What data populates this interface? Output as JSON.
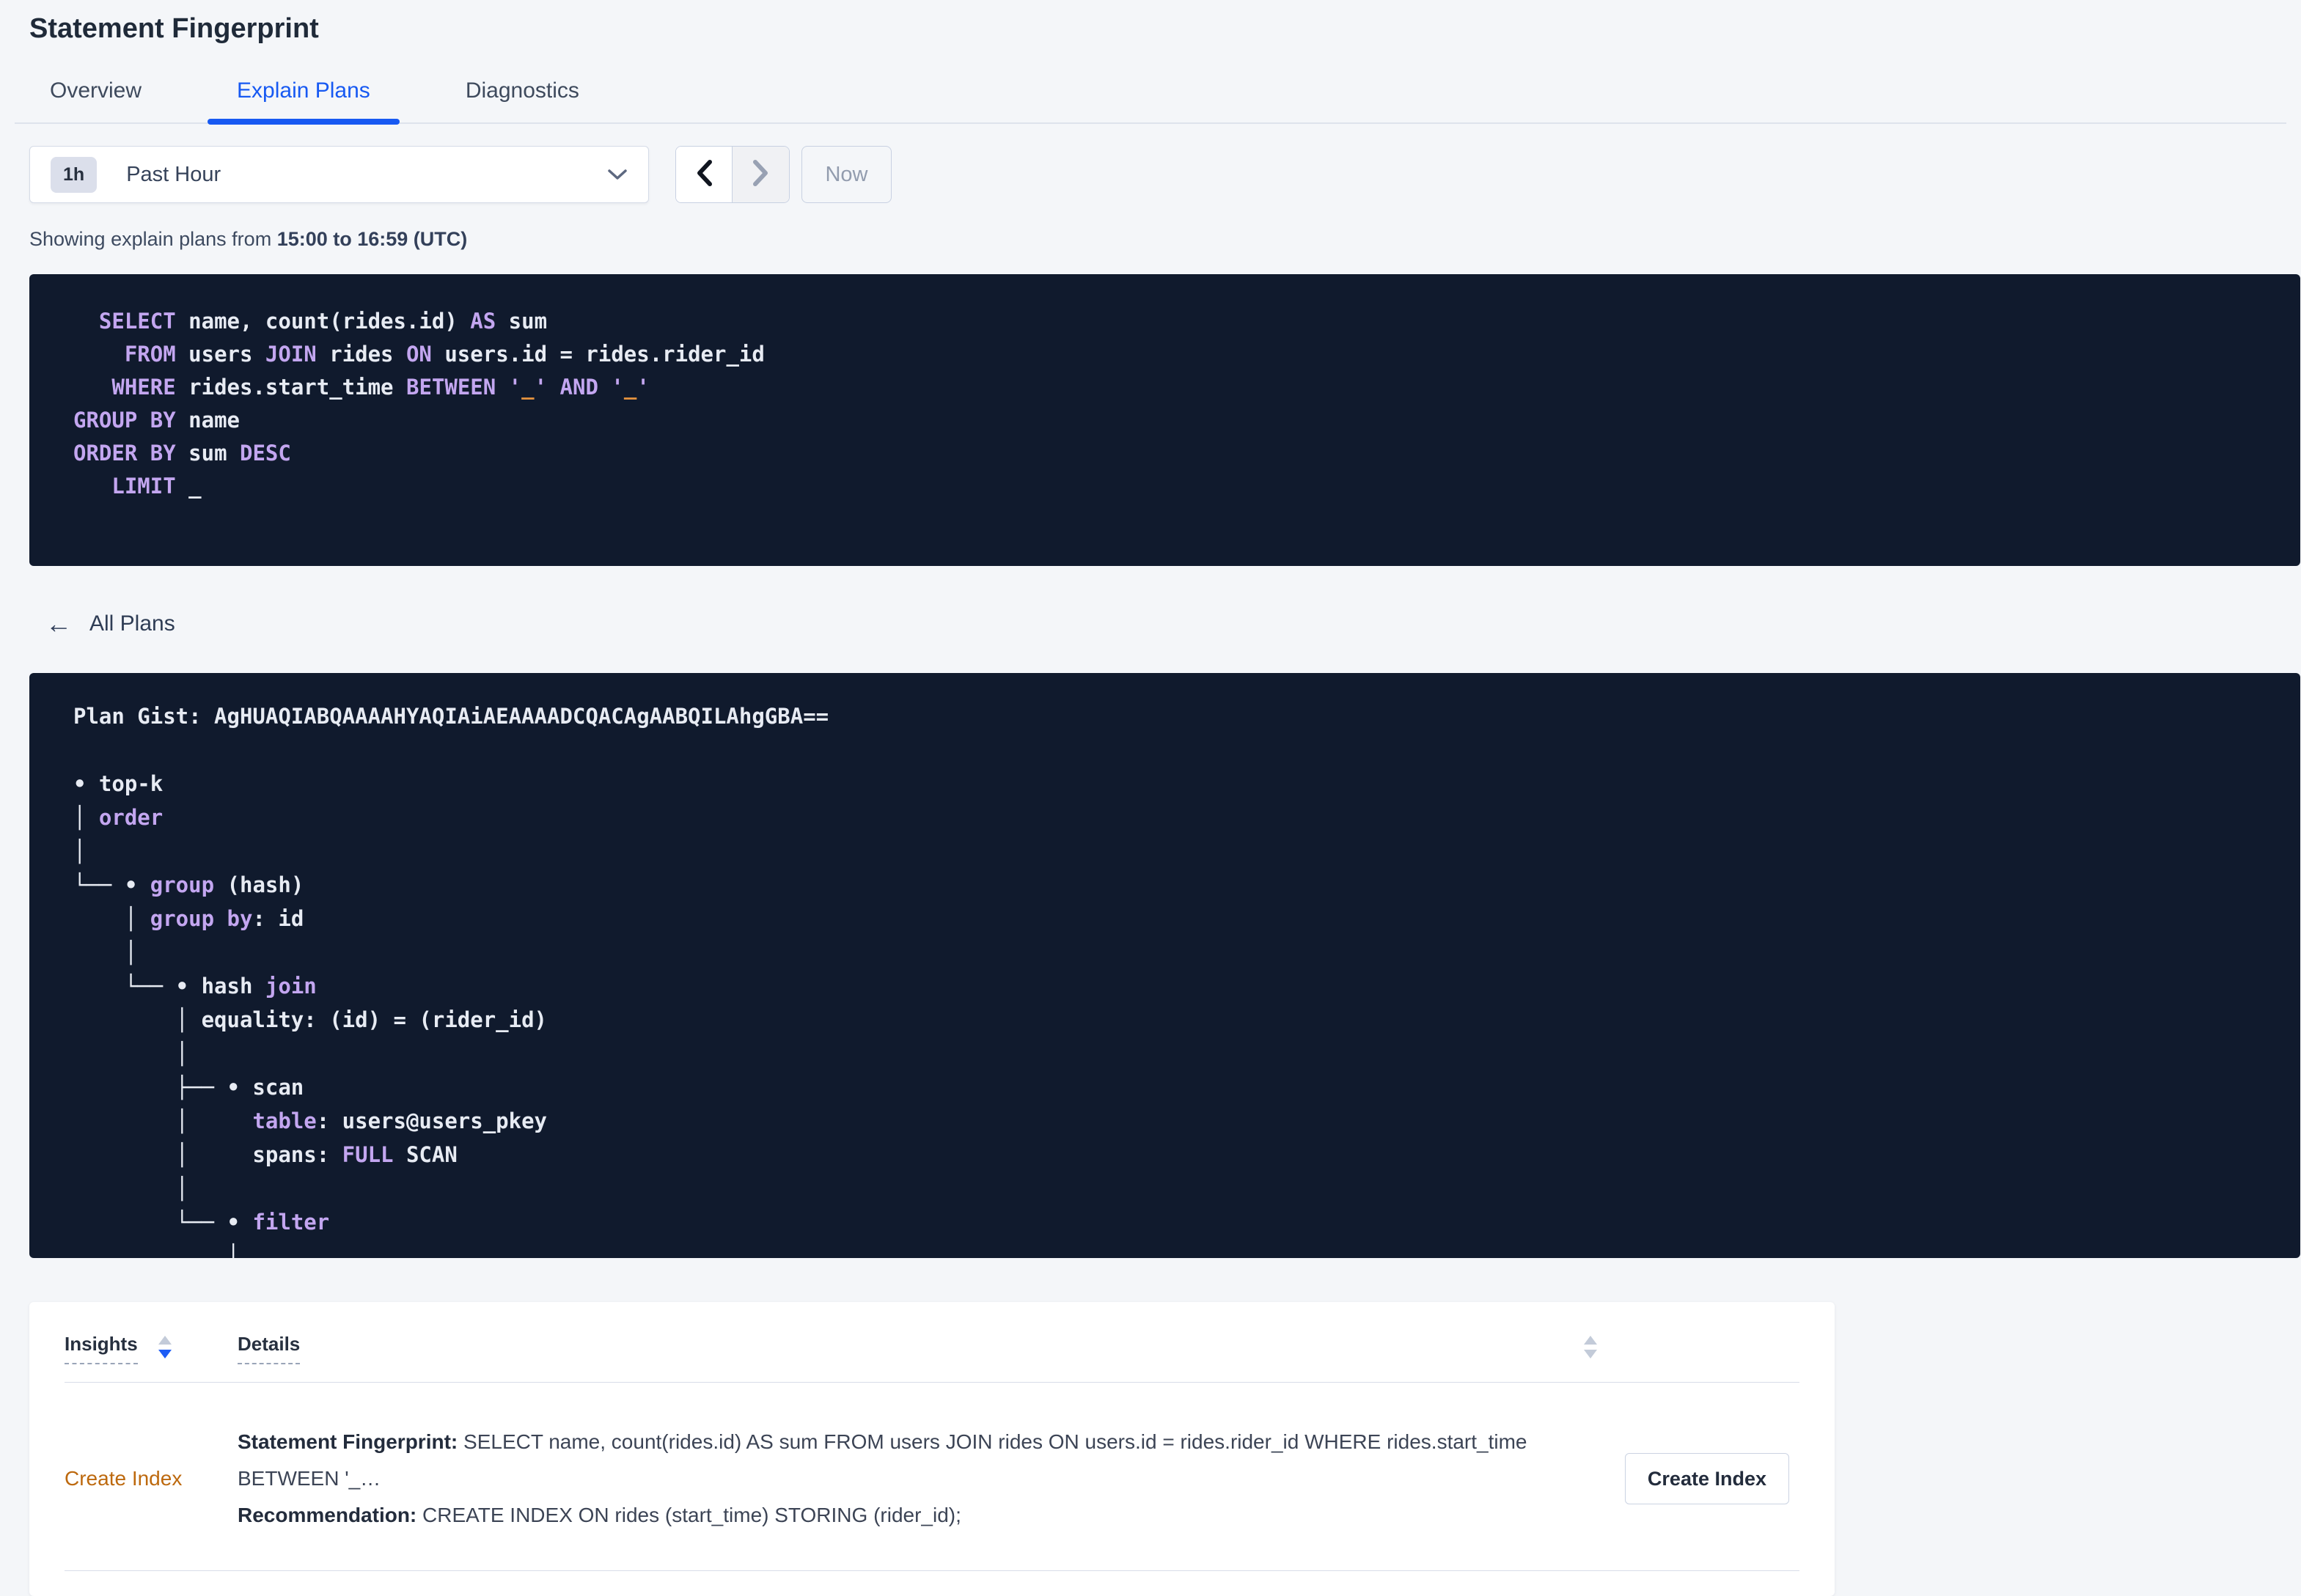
{
  "page": {
    "title": "Statement Fingerprint"
  },
  "tabs": [
    {
      "label": "Overview"
    },
    {
      "label": "Explain Plans"
    },
    {
      "label": "Diagnostics"
    }
  ],
  "toolbar": {
    "time_badge": "1h",
    "time_label": "Past Hour",
    "now_label": "Now"
  },
  "subtitle": {
    "prefix": "Showing explain plans from ",
    "bold": "15:00 to 16:59 (UTC)"
  },
  "sql_block": {
    "lines": [
      [
        [
          "p",
          "  "
        ],
        [
          "k",
          "SELECT"
        ],
        [
          "p",
          " name, count(rides.id) "
        ],
        [
          "k",
          "AS"
        ],
        [
          "p",
          " sum"
        ]
      ],
      [
        [
          "p",
          "    "
        ],
        [
          "k",
          "FROM"
        ],
        [
          "p",
          " users "
        ],
        [
          "k",
          "JOIN"
        ],
        [
          "p",
          " rides "
        ],
        [
          "k",
          "ON"
        ],
        [
          "p",
          " users.id = rides.rider_id"
        ]
      ],
      [
        [
          "p",
          "   "
        ],
        [
          "k",
          "WHERE"
        ],
        [
          "p",
          " rides.start_time "
        ],
        [
          "k",
          "BETWEEN"
        ],
        [
          "p",
          " "
        ],
        [
          "k",
          "'"
        ],
        [
          "o",
          "_"
        ],
        [
          "k",
          "'"
        ],
        [
          "p",
          " "
        ],
        [
          "k",
          "AND"
        ],
        [
          "p",
          " "
        ],
        [
          "k",
          "'"
        ],
        [
          "o",
          "_"
        ],
        [
          "k",
          "'"
        ]
      ],
      [
        [
          "k",
          "GROUP BY"
        ],
        [
          "p",
          " name"
        ]
      ],
      [
        [
          "k",
          "ORDER BY"
        ],
        [
          "p",
          " sum "
        ],
        [
          "k",
          "DESC"
        ]
      ],
      [
        [
          "p",
          "   "
        ],
        [
          "k",
          "LIMIT"
        ],
        [
          "p",
          " _"
        ]
      ]
    ]
  },
  "back_link": {
    "label": "All Plans",
    "arrow": "←"
  },
  "plan_block": {
    "lines": [
      [
        [
          "g",
          "Plan Gist: AgHUAQIABQAAAAHYAQIAiAEAAAADCQACAgAABQILAhgGBA=="
        ]
      ],
      [],
      [
        [
          "p",
          "• top-k"
        ]
      ],
      [
        [
          "p",
          "│ "
        ],
        [
          "k",
          "order"
        ]
      ],
      [
        [
          "p",
          "│"
        ]
      ],
      [
        [
          "p",
          "└── • "
        ],
        [
          "k",
          "group"
        ],
        [
          "p",
          " (hash)"
        ]
      ],
      [
        [
          "p",
          "    │ "
        ],
        [
          "k",
          "group by"
        ],
        [
          "p",
          ": id"
        ]
      ],
      [
        [
          "p",
          "    │"
        ]
      ],
      [
        [
          "p",
          "    └── • hash "
        ],
        [
          "k",
          "join"
        ]
      ],
      [
        [
          "p",
          "        │ equality: (id) = (rider_id)"
        ]
      ],
      [
        [
          "p",
          "        │"
        ]
      ],
      [
        [
          "p",
          "        ├── • scan"
        ]
      ],
      [
        [
          "p",
          "        │     "
        ],
        [
          "k",
          "table"
        ],
        [
          "p",
          ": users@users_pkey"
        ]
      ],
      [
        [
          "p",
          "        │     spans: "
        ],
        [
          "k",
          "FULL"
        ],
        [
          "p",
          " SCAN"
        ]
      ],
      [
        [
          "p",
          "        │"
        ]
      ],
      [
        [
          "p",
          "        └── • "
        ],
        [
          "k",
          "filter"
        ]
      ],
      [
        [
          "p",
          "            │"
        ]
      ],
      [
        [
          "p",
          "            │"
        ]
      ]
    ]
  },
  "insights_table": {
    "columns": [
      {
        "label": "Insights"
      },
      {
        "label": "Details"
      }
    ],
    "rows": [
      {
        "insight": "Create Index",
        "detail_lines": [
          {
            "label": "Statement Fingerprint:",
            "text": " SELECT name, count(rides.id) AS sum FROM users JOIN rides ON users.id = rides.rider_id WHERE rides.start_time BETWEEN '_…"
          },
          {
            "label": "Recommendation:",
            "text": " CREATE INDEX ON rides (start_time) STORING (rider_id);"
          }
        ],
        "action_label": "Create Index"
      }
    ]
  },
  "colors": {
    "accent_blue": "#1759f2",
    "code_background": "#101a2d",
    "keyword_purple": "#c3a6f0",
    "literal_orange": "#e5933f",
    "insight_link_orange": "#bd690e"
  }
}
